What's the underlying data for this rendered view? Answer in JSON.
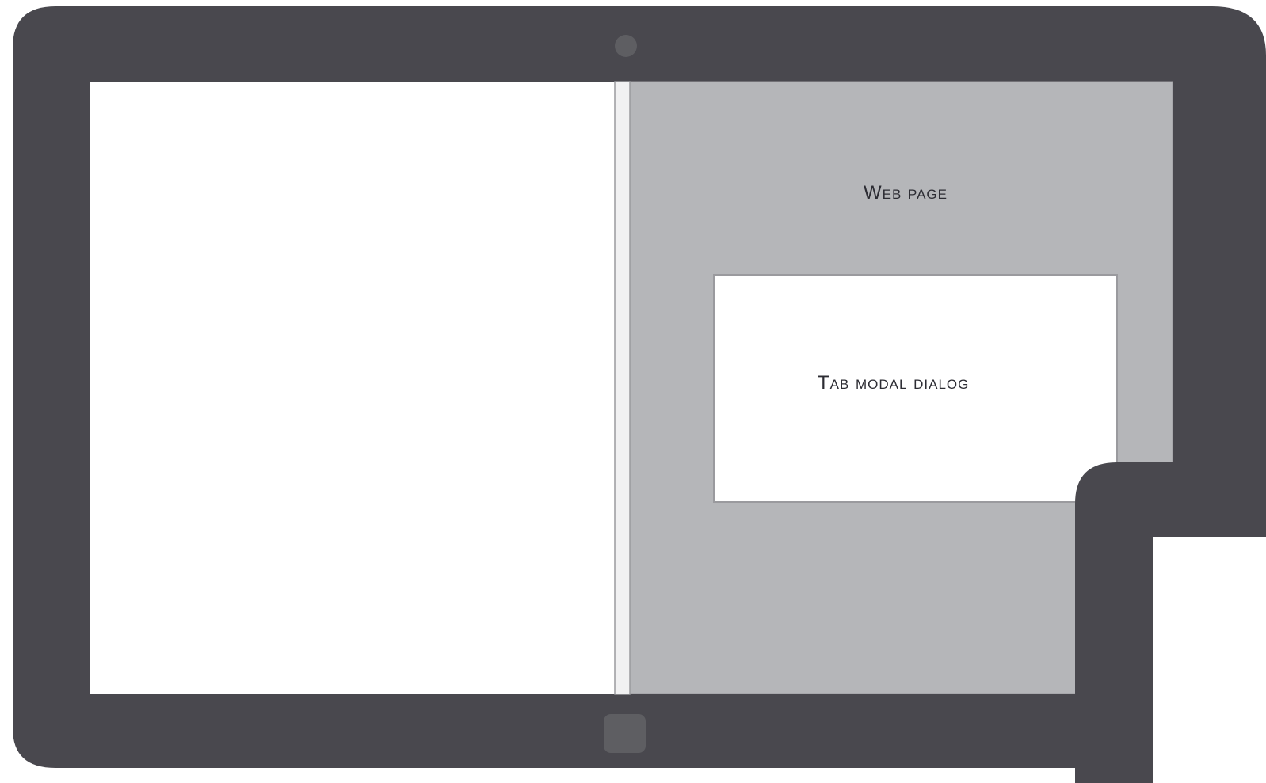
{
  "labels": {
    "web_page": "Web page",
    "tab_modal_dialog": "Tab modal dialog"
  },
  "colors": {
    "bezel": "#49484e",
    "web_page_fill": "#b5b6b9",
    "dialog_fill": "#ffffff",
    "left_pane_fill": "#ffffff",
    "divider_fill": "#f1f1f2",
    "border": "#9a9a9e",
    "camera": "#5e5e62",
    "home_button": "#5e5e62"
  },
  "icons": {
    "camera": "camera-icon",
    "home_button": "home-button-icon"
  }
}
